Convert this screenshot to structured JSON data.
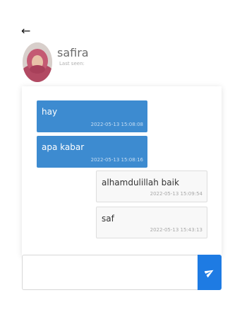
{
  "header": {
    "back_icon": "←",
    "contact_name": "safira",
    "last_seen": "Last seen:"
  },
  "messages": [
    {
      "text": "hay",
      "time": "2022-05-13 15:08:08",
      "direction": "sent"
    },
    {
      "text": "apa kabar",
      "time": "2022-05-13 15:08:16",
      "direction": "sent"
    },
    {
      "text": "alhamdulillah baik",
      "time": "2022-05-13 15:09:54",
      "direction": "received"
    },
    {
      "text": "saf",
      "time": "2022-05-13 15:43:13",
      "direction": "received"
    }
  ],
  "composer": {
    "value": "",
    "send_icon": "send-icon"
  },
  "colors": {
    "sent_bubble": "#3d8bd0",
    "received_bubble": "#f8f8f8",
    "send_button": "#1e7be3"
  }
}
